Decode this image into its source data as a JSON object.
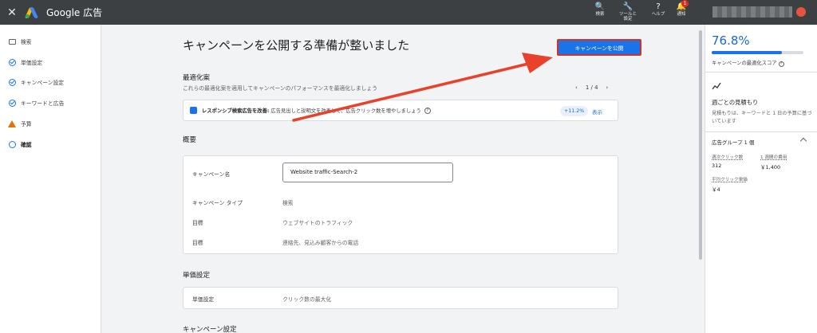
{
  "topbar": {
    "brand": "Google 広告",
    "tools": [
      {
        "label": "検索",
        "icon": "search-icon"
      },
      {
        "label": "ツールと設定",
        "icon": "wrench-icon"
      },
      {
        "label": "ヘルプ",
        "icon": "help-icon"
      },
      {
        "label": "通知",
        "icon": "bell-icon",
        "badge": "1"
      }
    ]
  },
  "sidebar": {
    "items": [
      {
        "label": "検索",
        "icon": "search-box-icon"
      },
      {
        "label": "単価設定",
        "icon": "check-circle-icon"
      },
      {
        "label": "キャンペーン設定",
        "icon": "check-circle-icon"
      },
      {
        "label": "キーワードと広告",
        "icon": "check-circle-icon"
      },
      {
        "label": "予算",
        "icon": "warning-icon"
      },
      {
        "label": "確認",
        "icon": "circle-icon"
      }
    ]
  },
  "main": {
    "title": "キャンペーンを公開する準備が整いました",
    "publish_label": "キャンペーンを公開",
    "optimization": {
      "title": "最適化案",
      "subtitle": "これらの最適化案を適用してキャンペーンのパフォーマンスを最適化しましょう",
      "pager": "1 / 4",
      "recommendation_title": "レスポンシブ検索広告を改善:",
      "recommendation_text": "広告見出しと説明文を改善して、広告クリック数を増やしましょう",
      "uplift": "+11.2%",
      "show": "表示"
    },
    "summary": {
      "title": "概要",
      "rows": [
        {
          "label": "キャンペーン名",
          "value": "Website traffic-Search-2"
        },
        {
          "label": "キャンペーン タイプ",
          "value": "検索"
        },
        {
          "label": "目標",
          "value": "ウェブサイトのトラフィック"
        },
        {
          "label": "目標",
          "value": "連絡先、見込み顧客からの電話"
        }
      ]
    },
    "bidding": {
      "title": "単価設定",
      "label": "単価設定",
      "value": "クリック数の最大化"
    },
    "next_section": "キャンペーン設定"
  },
  "right_panel": {
    "score": "76.8%",
    "score_fraction": 0.768,
    "score_label": "キャンペーンの最適化スコア",
    "estimate_title": "週ごとの見積もり",
    "estimate_desc": "見積もりは、キーワードと 1 日の予算に基づいています",
    "group_title": "広告グループ 1 個",
    "metrics": [
      {
        "label": "週次クリック数",
        "value": "312"
      },
      {
        "label": "1 週間の費用",
        "value": "￥1,400"
      },
      {
        "label": "平均クリック単価",
        "value": "￥4"
      }
    ]
  },
  "colors": {
    "accent": "#1a73e8",
    "highlight": "#d93025",
    "warning": "#e37400"
  }
}
